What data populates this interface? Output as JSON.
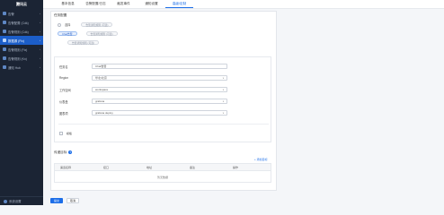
{
  "brand": "腾讯云",
  "sidebar": {
    "items": [
      {
        "label": "告警",
        "active": false
      },
      {
        "label": "告警配置 (Cdk)",
        "active": false
      },
      {
        "label": "告警规则 (Cdk)",
        "active": false
      },
      {
        "label": "数据源 (Fix)",
        "active": true
      },
      {
        "label": "告警规则 (Fix)",
        "active": false
      },
      {
        "label": "告警规则 (Kn)",
        "active": false
      },
      {
        "label": "通知 Hub",
        "active": false
      }
    ],
    "bottom_label": "系统设置"
  },
  "tabs": [
    {
      "label": "基本信息",
      "active": false
    },
    {
      "label": "告警配置/日志",
      "active": false
    },
    {
      "label": "触发事件",
      "active": false
    },
    {
      "label": "通知设置",
      "active": false
    },
    {
      "label": "高级/定制",
      "active": true
    }
  ],
  "section_title": "任务配置",
  "radio_options": [
    {
      "label": "选择",
      "pill": "告警通知规则 (可选)",
      "selected": false
    },
    {
      "label": "Chat告警",
      "pill": "告警通知规则 (可选)",
      "selected": true
    },
    {
      "label": "",
      "pill": "告警通知规则 (可选)",
      "selected": false
    }
  ],
  "form": {
    "rows": [
      {
        "label": "任务名",
        "value": "Chat告警",
        "dropdown": false
      },
      {
        "label": "Region",
        "value": "华北/北京",
        "dropdown": true
      },
      {
        "label": "工作空间",
        "value": "workspace",
        "dropdown": true
      },
      {
        "label": "仪表盘",
        "value": "grafana",
        "dropdown": true
      },
      {
        "label": "图表项",
        "value": "grafana deploy",
        "dropdown": true
      }
    ],
    "checkbox_label": "模板"
  },
  "notify_section": {
    "title": "传递目标",
    "add_link": "+ 添加目标",
    "columns": [
      "渠道名称",
      "接口",
      "地址",
      "备注",
      "操作"
    ],
    "empty_text": "暂无数据"
  },
  "buttons": {
    "submit": "提交",
    "cancel": "取消"
  }
}
